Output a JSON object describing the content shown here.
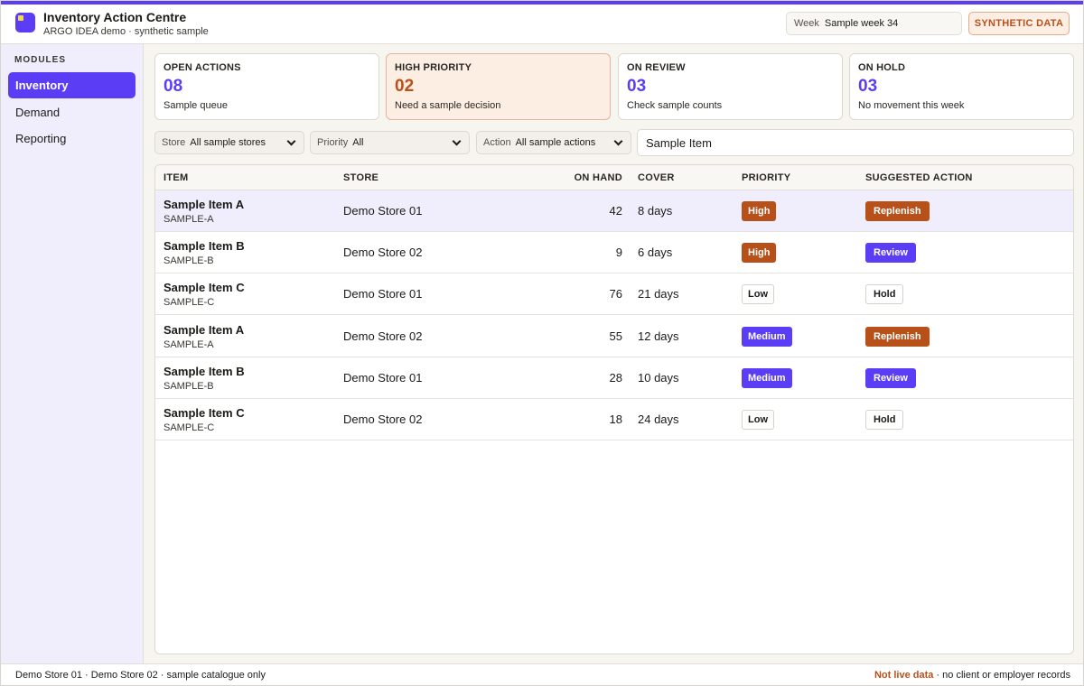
{
  "header": {
    "title": "Inventory Action Centre",
    "subtitle": "ARGO IDEA demo · synthetic sample",
    "week_label": "Week",
    "week_value": "Sample week 34",
    "synthetic_badge": "SYNTHETIC DATA"
  },
  "sidebar": {
    "heading": "MODULES",
    "items": [
      {
        "label": "Inventory",
        "active": true
      },
      {
        "label": "Demand",
        "active": false
      },
      {
        "label": "Reporting",
        "active": false
      }
    ]
  },
  "cards": [
    {
      "label": "OPEN ACTIONS",
      "value": "08",
      "note": "Sample queue"
    },
    {
      "label": "HIGH PRIORITY",
      "value": "02",
      "note": "Need a sample decision"
    },
    {
      "label": "ON REVIEW",
      "value": "03",
      "note": "Check sample counts"
    },
    {
      "label": "ON HOLD",
      "value": "03",
      "note": "No movement this week"
    }
  ],
  "filters": {
    "store": {
      "label": "Store",
      "value": "All sample stores"
    },
    "priority": {
      "label": "Priority",
      "value": "All"
    },
    "action": {
      "label": "Action",
      "value": "All sample actions"
    },
    "search_value": "Sample Item"
  },
  "table": {
    "columns": [
      "ITEM",
      "STORE",
      "ON HAND",
      "COVER",
      "PRIORITY",
      "SUGGESTED ACTION"
    ],
    "rows": [
      {
        "name": "Sample Item A",
        "code": "SAMPLE-A",
        "store": "Demo Store 01",
        "on_hand": "42",
        "cover": "8 days",
        "priority": "High",
        "action": "Replenish"
      },
      {
        "name": "Sample Item B",
        "code": "SAMPLE-B",
        "store": "Demo Store 02",
        "on_hand": "9",
        "cover": "6 days",
        "priority": "High",
        "action": "Review"
      },
      {
        "name": "Sample Item C",
        "code": "SAMPLE-C",
        "store": "Demo Store 01",
        "on_hand": "76",
        "cover": "21 days",
        "priority": "Low",
        "action": "Hold"
      },
      {
        "name": "Sample Item A",
        "code": "SAMPLE-A",
        "store": "Demo Store 02",
        "on_hand": "55",
        "cover": "12 days",
        "priority": "Medium",
        "action": "Replenish"
      },
      {
        "name": "Sample Item B",
        "code": "SAMPLE-B",
        "store": "Demo Store 01",
        "on_hand": "28",
        "cover": "10 days",
        "priority": "Medium",
        "action": "Review"
      },
      {
        "name": "Sample Item C",
        "code": "SAMPLE-C",
        "store": "Demo Store 02",
        "on_hand": "18",
        "cover": "24 days",
        "priority": "Low",
        "action": "Hold"
      }
    ]
  },
  "footer": {
    "left": "Demo Store 01 · Demo Store 02 · sample catalogue only",
    "warning": "Not live data",
    "right_rest": " · no client or employer records"
  },
  "colors": {
    "accent": "#5b3df5",
    "high": "#b8501a",
    "sidebar_bg": "#f0eefc"
  }
}
